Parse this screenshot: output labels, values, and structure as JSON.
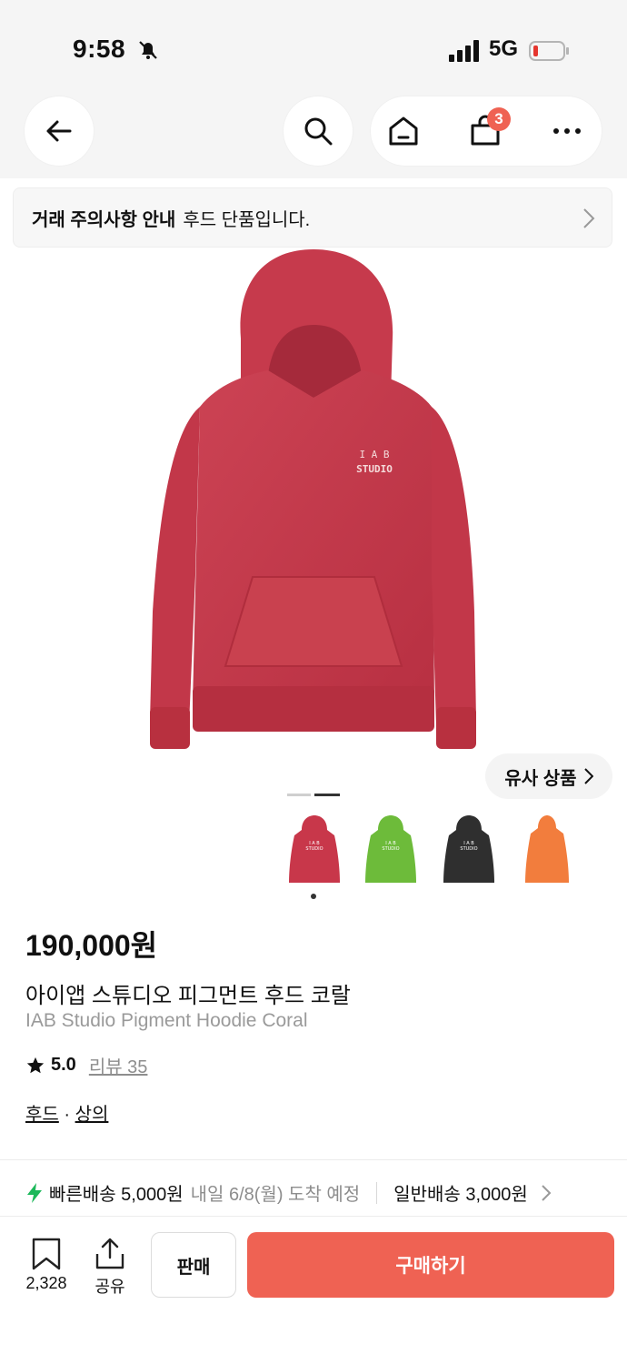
{
  "status_bar": {
    "time": "9:58",
    "network": "5G"
  },
  "top_nav": {
    "cart_count": "3"
  },
  "notice": {
    "bold": "거래 주의사항 안내",
    "text": "후드 단품입니다."
  },
  "product": {
    "logo_line1": "I A B",
    "logo_line2": "STUDIO",
    "similar_label": "유사 상품",
    "price": "190,000원",
    "name_ko": "아이앱 스튜디오 피그먼트 후드 코랄",
    "name_en": "IAB Studio Pigment Hoodie Coral",
    "rating": "5.0",
    "review_label": "리뷰 35",
    "category1": "후드",
    "category_sep": " · ",
    "category2": "상의",
    "colors": [
      "#c8374a",
      "#6dbb3a",
      "#2f2f2f",
      "#f27d3d"
    ]
  },
  "shipping": {
    "fast_label": "빠른배송 5,000원",
    "fast_eta": "내일 6/8(월) 도착 예정",
    "normal_label": "일반배송 3,000원"
  },
  "bottom_bar": {
    "saved_count": "2,328",
    "share_label": "공유",
    "sell_label": "판매",
    "buy_label": "구매하기"
  }
}
